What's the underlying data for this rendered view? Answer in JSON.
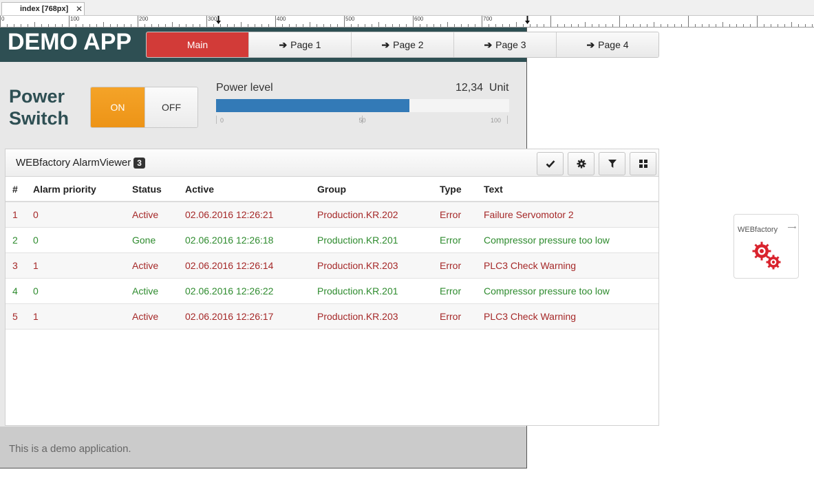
{
  "editor": {
    "tab_label": "index [768px]",
    "close_glyph": "✕",
    "ruler_labels": [
      "0",
      "100",
      "200",
      "300",
      "400",
      "500",
      "600",
      "700"
    ]
  },
  "header": {
    "brand": "DEMO APP",
    "nav": [
      {
        "label": "Main",
        "active": true
      },
      {
        "label": "Page 1",
        "icon": "arrow-right-icon"
      },
      {
        "label": "Page 2",
        "icon": "arrow-right-icon"
      },
      {
        "label": "Page 3",
        "icon": "arrow-right-icon"
      },
      {
        "label": "Page 4",
        "icon": "arrow-right-icon"
      }
    ]
  },
  "power": {
    "title_line1": "Power",
    "title_line2": "Switch",
    "on_label": "ON",
    "off_label": "OFF",
    "state": "ON",
    "level_label": "Power level",
    "level_value": "12,34  Unit",
    "bar_percent": 66,
    "scale": [
      "0",
      "50",
      "100"
    ]
  },
  "alarm": {
    "title": "WEBfactory AlarmViewer",
    "count": "3",
    "tools": [
      "check-icon",
      "gear-icon",
      "filter-icon",
      "grid-icon"
    ],
    "columns": [
      "#",
      "Alarm priority",
      "Status",
      "Active",
      "Group",
      "Type",
      "Text"
    ],
    "rows": [
      {
        "n": "1",
        "priority": "0",
        "status": "Active",
        "active": "02.06.2016 12:26:21",
        "group": "Production.KR.202",
        "type": "Error",
        "text": "Failure Servomotor 2",
        "color": "#a52828"
      },
      {
        "n": "2",
        "priority": "0",
        "status": "Gone",
        "active": "02.06.2016 12:26:18",
        "group": "Production.KR.201",
        "type": "Error",
        "text": "Compressor pressure too low",
        "color": "#2e8b2e"
      },
      {
        "n": "3",
        "priority": "1",
        "status": "Active",
        "active": "02.06.2016 12:26:14",
        "group": "Production.KR.203",
        "type": "Error",
        "text": "PLC3 Check Warning",
        "color": "#a52828"
      },
      {
        "n": "4",
        "priority": "0",
        "status": "Active",
        "active": "02.06.2016 12:26:22",
        "group": "Production.KR.201",
        "type": "Error",
        "text": "Compressor pressure too low",
        "color": "#2e8b2e"
      },
      {
        "n": "5",
        "priority": "1",
        "status": "Active",
        "active": "02.06.2016 12:26:17",
        "group": "Production.KR.203",
        "type": "Error",
        "text": "PLC3 Check Warning",
        "color": "#a52828"
      }
    ]
  },
  "footer": {
    "text": "This is a demo application."
  },
  "logo": {
    "text": "WEBfactory",
    "accent": "#d9232d"
  },
  "colors": {
    "header": "#2e4f53",
    "nav_active": "#d23b38",
    "on": "#f0981b",
    "bar": "#337ab7"
  }
}
